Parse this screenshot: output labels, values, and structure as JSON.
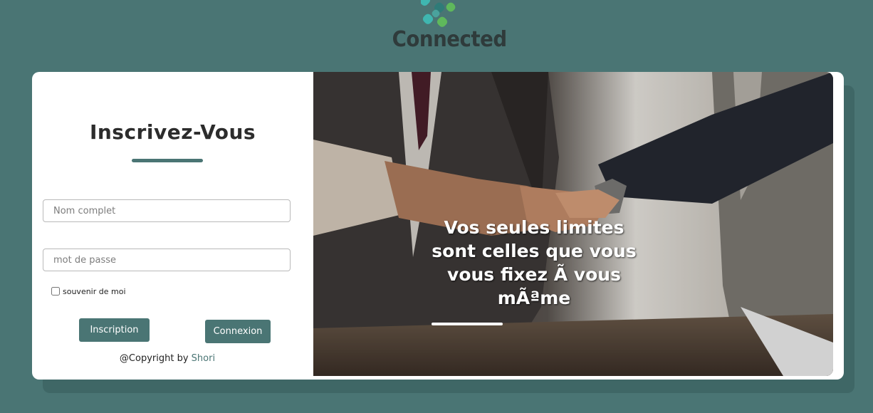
{
  "brand": {
    "name": "Connected",
    "logo_icon": "molecule-icon",
    "colors": {
      "dot_teal": "#3fb6b0",
      "dot_green": "#5fb85c",
      "dot_dark": "#2f7b78"
    }
  },
  "colors": {
    "accent": "#4a7574",
    "background": "#4a7574",
    "card": "#ffffff"
  },
  "form": {
    "title": "Inscrivez-Vous",
    "name_placeholder": "Nom complet",
    "password_placeholder": "mot de passe",
    "remember_label": "souvenir de moi",
    "remember_checked": false,
    "signup_button": "Inscription",
    "login_button": "Connexion",
    "copyright_prefix": "@Copyright by",
    "copyright_author": "Shori"
  },
  "hero": {
    "image_subject": "handshake-photo",
    "quote": "Vos seules limites sont celles que vous vous fixez Ã  vous mÃªme"
  }
}
